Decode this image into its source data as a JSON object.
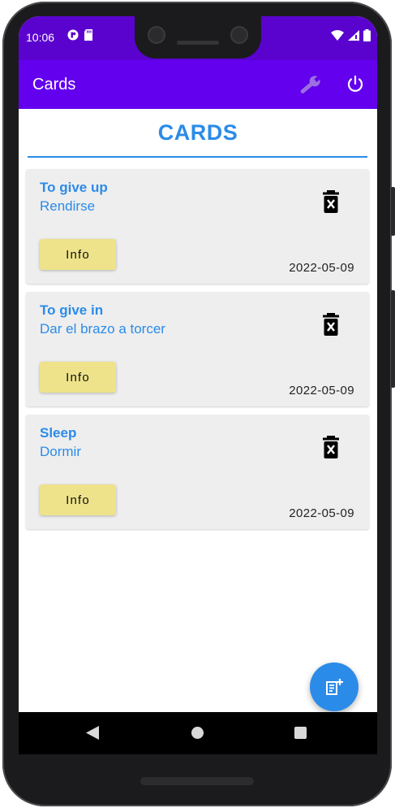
{
  "status_bar": {
    "time": "10:06",
    "left_icons": [
      "app-notification-icon",
      "sd-card-icon"
    ],
    "right_icons": [
      "wifi-icon",
      "signal-icon",
      "battery-icon"
    ]
  },
  "app_bar": {
    "title": "Cards",
    "actions": [
      "wrench-icon",
      "power-icon"
    ]
  },
  "page": {
    "heading": "CARDS"
  },
  "cards": [
    {
      "title": "To give up",
      "subtitle": "Rendirse",
      "button_label": "Info",
      "date": "2022-05-09"
    },
    {
      "title": "To give in",
      "subtitle": "Dar el brazo a torcer",
      "button_label": "Info",
      "date": "2022-05-09"
    },
    {
      "title": "Sleep",
      "subtitle": "Dormir",
      "button_label": "Info",
      "date": "2022-05-09"
    }
  ],
  "fab": {
    "icon": "add-note-icon"
  },
  "nav_bar": {
    "buttons": [
      "back-icon",
      "home-icon",
      "recents-icon"
    ]
  },
  "colors": {
    "status_bar": "#5a03cf",
    "app_bar": "#6300ee",
    "accent_blue": "#2b8be8",
    "card_background": "#eeeeee",
    "info_button": "#eee38a",
    "wrench": "#9b6fe0"
  }
}
